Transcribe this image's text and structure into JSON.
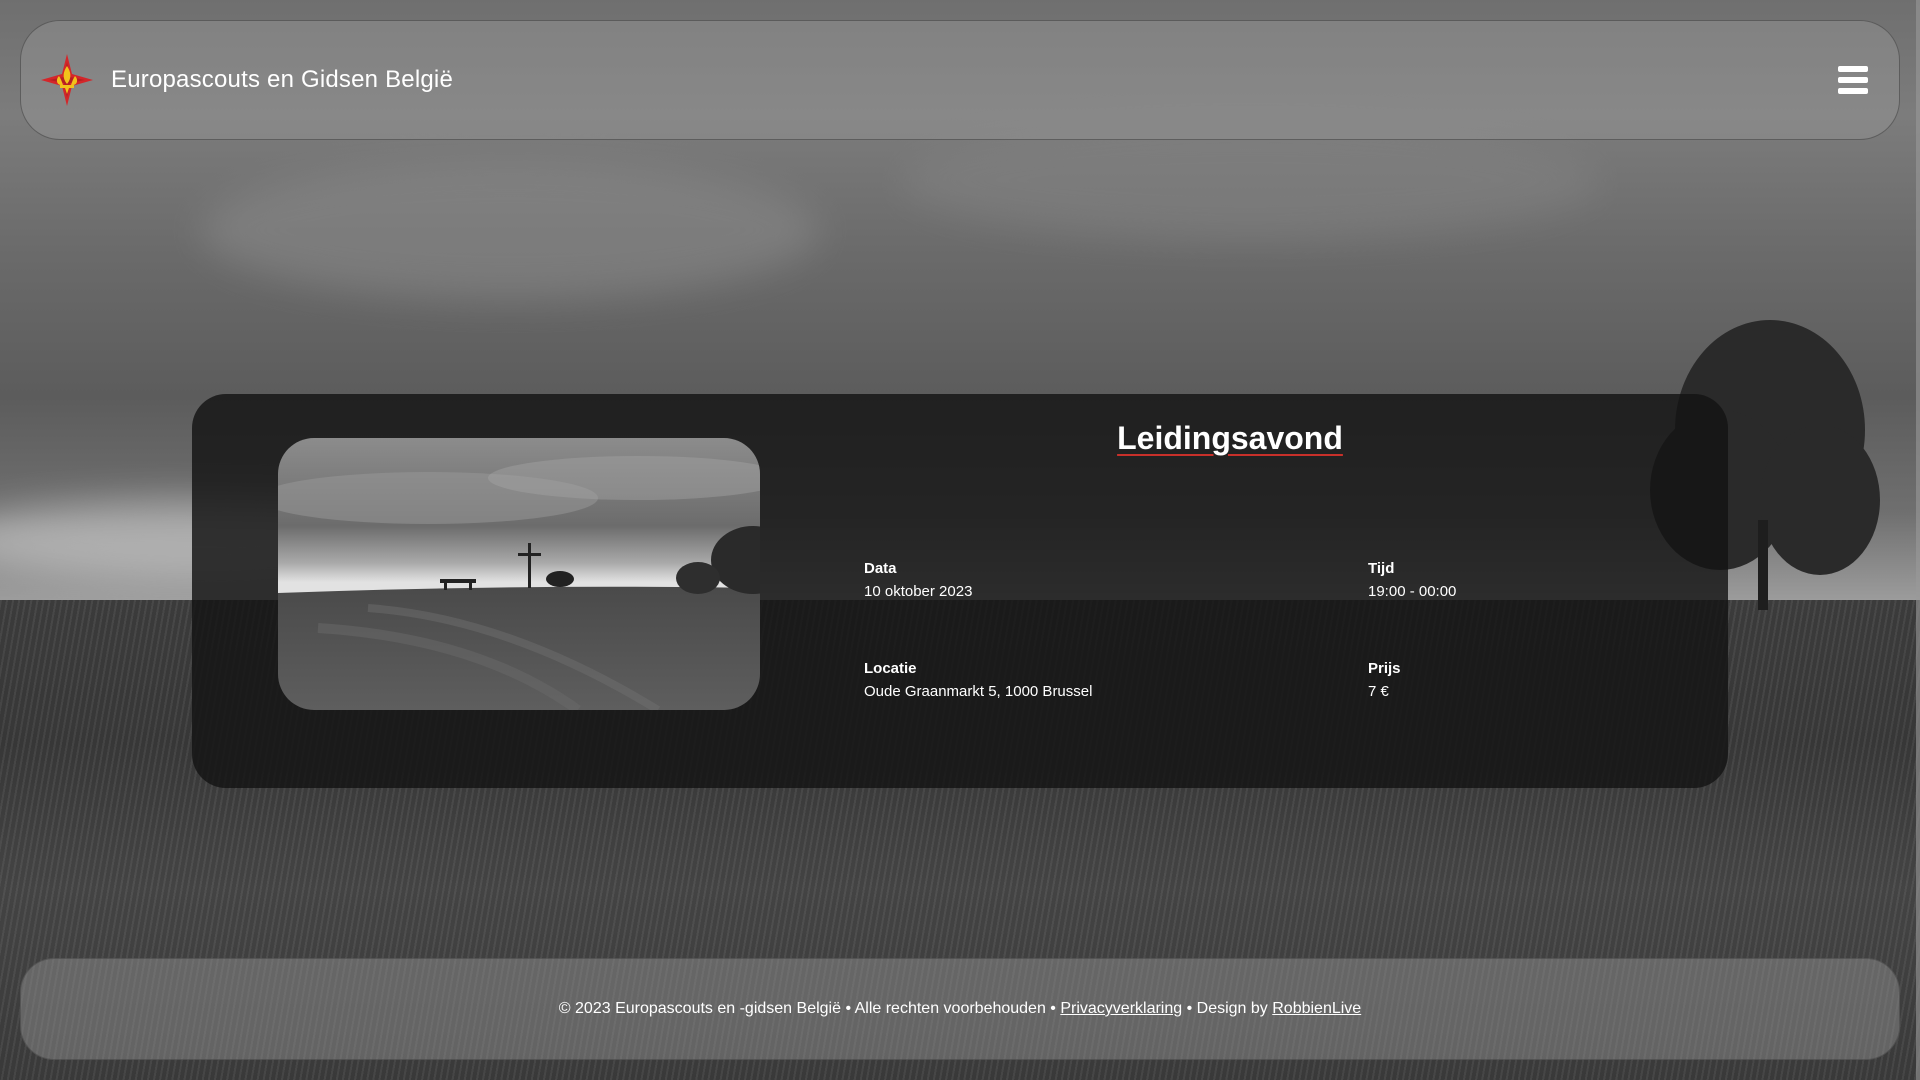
{
  "header": {
    "site_title": "Europascouts en Gidsen België",
    "logo_icon": "scout-fleur-de-lis-logo",
    "menu_icon": "hamburger-menu-icon"
  },
  "event": {
    "title": "Leidingsavond",
    "image_icon": "hilltop-cross-photo",
    "fields": {
      "date": {
        "label": "Data",
        "value": "10 oktober 2023"
      },
      "time": {
        "label": "Tijd",
        "value": "19:00 - 00:00"
      },
      "location": {
        "label": "Locatie",
        "value": "Oude Graanmarkt 5, 1000 Brussel"
      },
      "price": {
        "label": "Prijs",
        "value": "7 €"
      }
    }
  },
  "footer": {
    "copyright": "© 2023 Europascouts en -gidsen België • Alle rechten voorbehouden • ",
    "privacy_link": "Privacyverklaring",
    "design_prefix": " • Design by ",
    "designer_link": "RobbienLive"
  },
  "colors": {
    "accent_red": "#c8302a",
    "logo_red": "#d4262a",
    "logo_gold": "#f2c21b"
  }
}
